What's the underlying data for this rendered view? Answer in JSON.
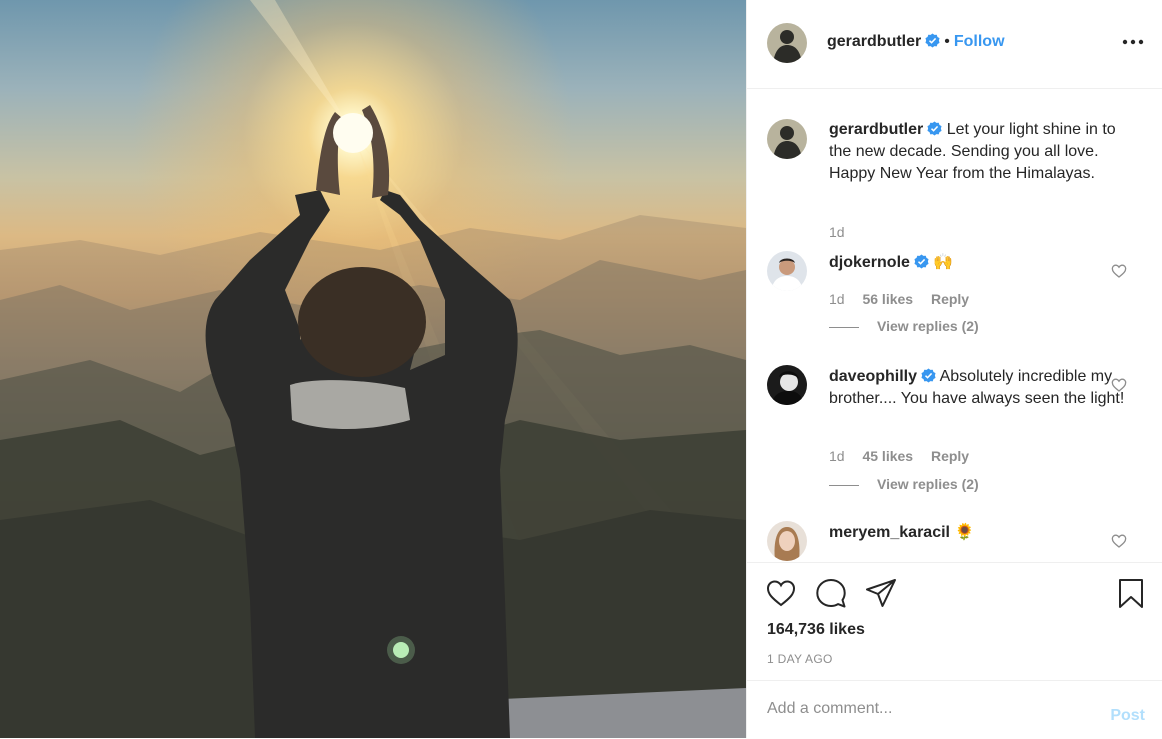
{
  "photo": {
    "alt_subject": "person-holding-sun-image"
  },
  "header": {
    "username": "gerardbutler",
    "separator": "•",
    "follow_label": "Follow",
    "more_icon": "more-horizontal-icon"
  },
  "caption": {
    "username": "gerardbutler",
    "text": "Let your light shine in to the new decade. Sending you all love. Happy New Year from the Himalayas.",
    "time": "1d"
  },
  "comments": [
    {
      "username": "djokernole",
      "text": "🙌",
      "time": "1d",
      "likes": "56 likes",
      "reply": "Reply",
      "view_replies": "View replies (2)"
    },
    {
      "username": "daveophilly",
      "text": "Absolutely incredible my brother.... You have always seen the light!",
      "time": "1d",
      "likes": "45 likes",
      "reply": "Reply",
      "view_replies": "View replies (2)"
    },
    {
      "username": "meryem_karacil",
      "text": "🌻"
    }
  ],
  "actions": {
    "likes": "164,736 likes",
    "date": "1 DAY AGO"
  },
  "add_comment": {
    "placeholder": "Add a comment...",
    "post_label": "Post"
  },
  "colors": {
    "link": "#3897f0",
    "post_disabled": "#b2dffc",
    "verified": "#3897f0",
    "muted": "#8e8e8e"
  }
}
